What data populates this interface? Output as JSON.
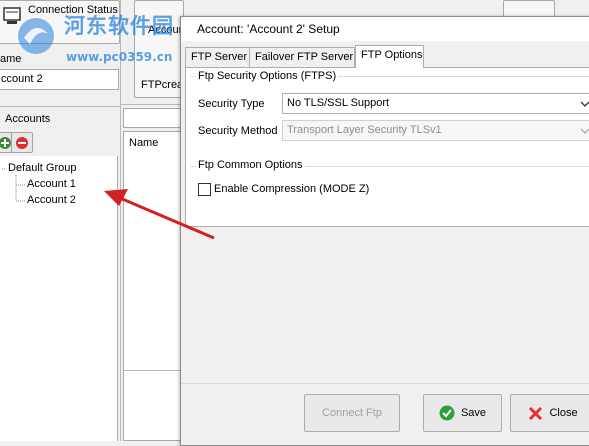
{
  "background_app": {
    "connection_status_label": "Connection Status",
    "name_label": "ame",
    "account_name_value": "ccount 2",
    "accounts_header": "Accounts",
    "toolbar_accoun_label": "Accoun",
    "toolbar_ftpcrea_label": "FTPcrea",
    "list_column_name": "Name",
    "tree": {
      "group": "Default Group",
      "items": [
        "Account 1",
        "Account 2"
      ]
    }
  },
  "dialog": {
    "title": "Account: 'Account 2' Setup",
    "tabs": [
      "FTP Server",
      "Failover FTP Server",
      "FTP Options"
    ],
    "active_tab": "FTP Options",
    "security_group": {
      "title": "Ftp Security Options (FTPS)",
      "security_type_label": "Security Type",
      "security_type_value": "No TLS/SSL Support",
      "security_method_label": "Security Method",
      "security_method_value": "Transport Layer Security TLSv1"
    },
    "common_group": {
      "title": "Ftp Common Options",
      "enable_compression_label": "Enable Compression (MODE Z)",
      "enable_compression_checked": false
    },
    "buttons": {
      "connect_label": "Connect Ftp",
      "save_label": "Save",
      "close_label": "Close"
    }
  },
  "watermark": {
    "text": "河东软件园",
    "url": "www.pc0359.cn"
  },
  "colors": {
    "annotation_arrow": "#d42020",
    "save_icon": "#2e9e3a",
    "close_icon": "#e03030",
    "watermark": "#2882dc"
  }
}
